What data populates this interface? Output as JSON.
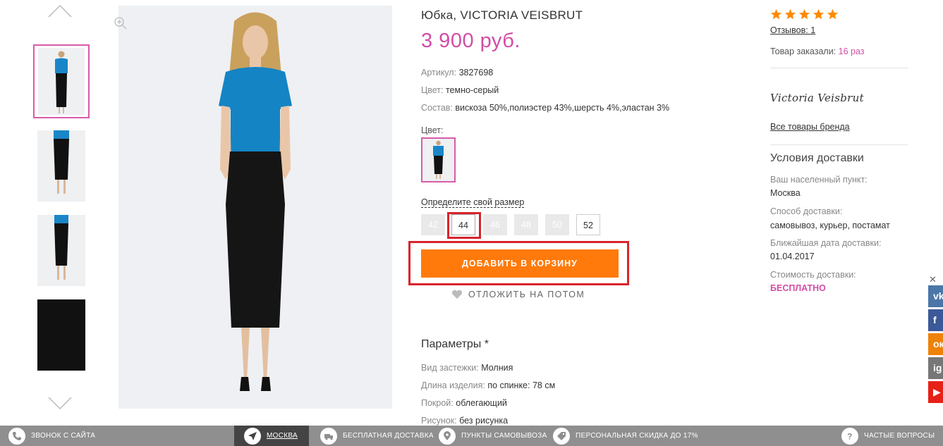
{
  "product": {
    "title": "Юбка, VICTORIA VEISBRUT",
    "price": "3 900 руб.",
    "attributes": [
      {
        "label": "Артикул:",
        "value": "3827698"
      },
      {
        "label": "Цвет:",
        "value": "темно-серый"
      },
      {
        "label": "Состав:",
        "value": "вискоза 50%,полиэстер 43%,шерсть 4%,эластан 3%"
      }
    ],
    "color_label": "Цвет:",
    "size_link": "Определите свой размер",
    "sizes": [
      {
        "label": "42",
        "available": false
      },
      {
        "label": "44",
        "available": true,
        "selected": true
      },
      {
        "label": "46",
        "available": false
      },
      {
        "label": "48",
        "available": false
      },
      {
        "label": "50",
        "available": false
      },
      {
        "label": "52",
        "available": true
      }
    ],
    "add_to_cart": "ДОБАВИТЬ В КОРЗИНУ",
    "save_later": "ОТЛОЖИТЬ НА ПОТОМ",
    "params_title": "Параметры *",
    "params": [
      {
        "label": "Вид застежки:",
        "value": "Молния"
      },
      {
        "label": "Длина изделия:",
        "value": "по спинке: 78 см"
      },
      {
        "label": "Покрой:",
        "value": "облегающий"
      },
      {
        "label": "Рисунок:",
        "value": "без рисунка"
      }
    ]
  },
  "sidebar": {
    "rating": 5,
    "reviews": "Отзывов: 1",
    "ordered_label": "Товар заказали:",
    "ordered_count": "16 раз",
    "brand_logo": "Victoria Veisbrut",
    "brand_all": "Все товары бренда",
    "delivery_title": "Условия доставки",
    "delivery": [
      {
        "label": "Ваш населенный пункт:",
        "value": "Москва"
      },
      {
        "label": "Способ доставки:",
        "value": "самовывоз, курьер, постамат"
      },
      {
        "label": "Ближайшая дата доставки:",
        "value": "01.04.2017"
      },
      {
        "label": "Стоимость доставки:",
        "value": "БЕСПЛАТНО"
      }
    ]
  },
  "social": [
    {
      "name": "vk",
      "glyph": "vk",
      "color": "#4a76a8"
    },
    {
      "name": "facebook",
      "glyph": "f",
      "color": "#3b5998"
    },
    {
      "name": "odnoklassniki",
      "glyph": "ок",
      "color": "#ee8208"
    },
    {
      "name": "instagram",
      "glyph": "ig",
      "color": "#777777"
    },
    {
      "name": "youtube",
      "glyph": "▶",
      "color": "#e62117"
    }
  ],
  "bottom_bar": [
    {
      "label": "ЗВОНОК С САЙТА",
      "icon": "phone-icon"
    },
    {
      "label": "МОСКВА",
      "icon": "location-arrow-icon"
    },
    {
      "label": "БЕСПЛАТНАЯ ДОСТАВКА",
      "icon": "truck-icon"
    },
    {
      "label": "ПУНКТЫ САМОВЫВОЗА",
      "icon": "map-pin-icon"
    },
    {
      "label": "ПЕРСОНАЛЬНАЯ СКИДКА ДО 17%",
      "icon": "tag-icon"
    },
    {
      "label": "ЧАСТЫЕ ВОПРОСЫ",
      "icon": "question-icon"
    }
  ],
  "colors": {
    "accent_pink": "#d34da6",
    "button_orange": "#ff7a0a",
    "highlight_red": "#d9242b",
    "star": "#ff8a00"
  }
}
